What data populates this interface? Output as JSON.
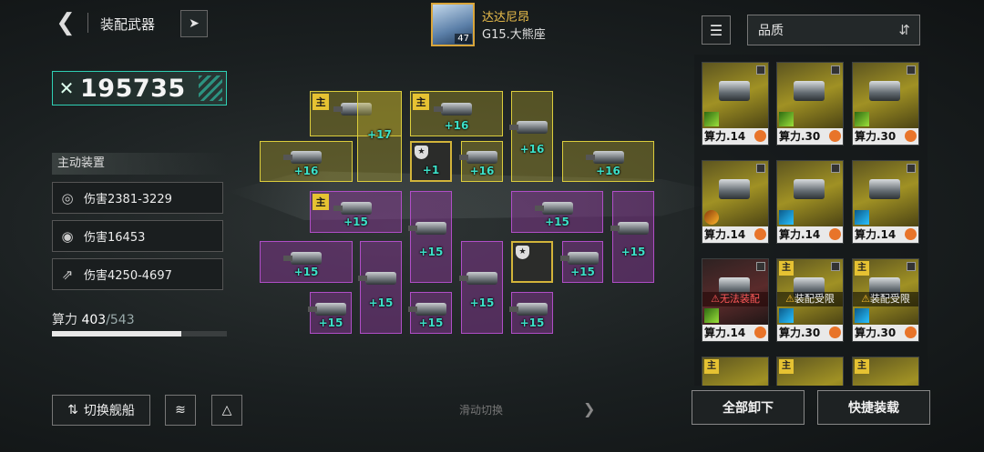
{
  "header": {
    "title": "装配武器",
    "captain_name": "达达尼昂",
    "captain_level": "47",
    "location": "G15.大熊座"
  },
  "power": {
    "value": "195735"
  },
  "active": {
    "title": "主动装置",
    "stats": [
      "伤害2381-3229",
      "伤害16453",
      "伤害4250-4697"
    ]
  },
  "capacity": {
    "label": "算力",
    "current": "403",
    "max": "/543",
    "fraction": 0.742
  },
  "buttons": {
    "switch_ship": "切换舰船",
    "unequip_all": "全部卸下",
    "quick_equip": "快捷装载",
    "swipe": "滑动切换"
  },
  "sort": {
    "label": "品质"
  },
  "slots": {
    "main": "主",
    "levels": [
      "+17",
      "+16",
      "+16",
      "+16",
      "+1",
      "+16",
      "+16",
      "+15",
      "+15",
      "+15",
      "+15",
      "+15",
      "+15",
      "+15",
      "+15",
      "+15",
      "+15",
      "+15",
      "+15",
      "+15"
    ]
  },
  "cards": [
    {
      "cost": "算力.14",
      "warn": ""
    },
    {
      "cost": "算力.30",
      "warn": ""
    },
    {
      "cost": "算力.30",
      "warn": ""
    },
    {
      "cost": "算力.14",
      "warn": ""
    },
    {
      "cost": "算力.14",
      "warn": ""
    },
    {
      "cost": "算力.14",
      "warn": ""
    },
    {
      "cost": "算力.14",
      "warn": "无法装配"
    },
    {
      "cost": "算力.30",
      "warn": "装配受限",
      "main": "主"
    },
    {
      "cost": "算力.30",
      "warn": "装配受限",
      "main": "主"
    },
    {
      "main": "主"
    },
    {
      "main": "主"
    },
    {
      "main": "主"
    }
  ],
  "colors": {
    "accent": "#2fd0b4",
    "yellow_slot": "#dccd3c",
    "purple_slot": "#b04ec7",
    "gold": "#e6c232"
  },
  "icons": [
    "back-arrow-icon",
    "rocket-icon",
    "swords-icon",
    "target-icon",
    "filter-icon",
    "sort-icon",
    "warning-icon"
  ]
}
